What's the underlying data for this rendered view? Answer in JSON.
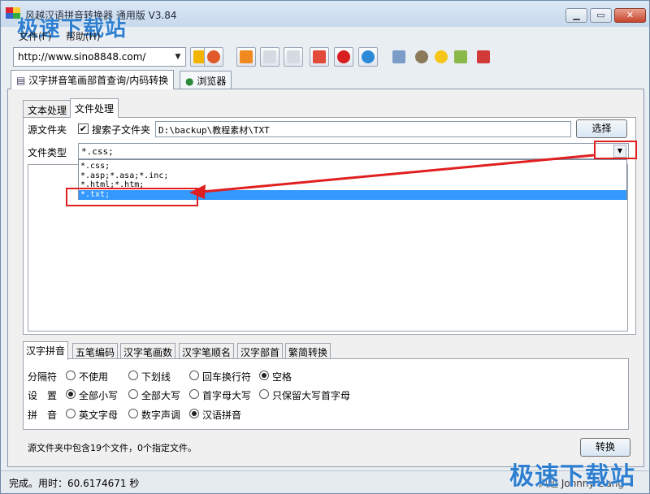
{
  "title": "风越汉语拼音转换器 通用版 V3.84",
  "watermark": "极速下载站",
  "menu": [
    "文件(F)",
    "帮助(H)"
  ],
  "toolbar": {
    "url": "http://www.sino8848.com/"
  },
  "main_tabs": [
    "汉字拼音笔画部首查询/内码转换",
    "浏览器"
  ],
  "sub_tabs": [
    "文本处理",
    "文件处理"
  ],
  "file": {
    "source_label": "源文件夹",
    "search_sub_label": "搜索子文件夹",
    "search_sub_checked": true,
    "path": "D:\\backup\\教程素材\\TXT",
    "choose_button": "选择",
    "type_label": "文件类型",
    "type_value": "*.css;",
    "type_options": [
      "*.css;",
      "*.asp;*.asa;*.inc;",
      "*.html;*.htm;",
      "*.txt;"
    ],
    "selected_option": "*.txt;"
  },
  "opt_tabs": [
    "汉字拼音",
    "五笔编码",
    "汉字笔画数",
    "汉字笔顺名",
    "汉字部首",
    "繁简转换"
  ],
  "options": {
    "separator_label": "分隔符",
    "separator": [
      "不使用",
      "下划线",
      "回车换行符",
      "空格"
    ],
    "separator_selected": "空格",
    "setting_label": "设　置",
    "setting": [
      "全部小写",
      "全部大写",
      "首字母大写",
      "只保留大写首字母"
    ],
    "setting_selected": "全部小写",
    "pinyin_label": "拼　音",
    "pinyin": [
      "英文字母",
      "数字声调",
      "汉语拼音"
    ],
    "pinyin_selected": "汉语拼音"
  },
  "summary": "源文件夹中包含19个文件，0个指定文件。",
  "convert_button": "转换",
  "statusbar": {
    "left": "完成。用时：60.6174671 秒",
    "right": "风越 Johnny Liang"
  },
  "colors": {
    "highlight": "#3399ff",
    "annotation": "#e02020",
    "watermark": "#2f7fd0"
  }
}
